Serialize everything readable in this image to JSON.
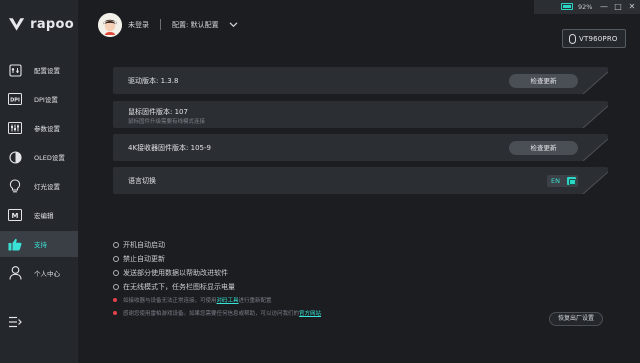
{
  "brand": {
    "name": "rapoo"
  },
  "sidebar": {
    "items": [
      {
        "label": "配置设置",
        "icon": "settings-sliders-icon"
      },
      {
        "label": "DPI设置",
        "icon": "dpi-icon"
      },
      {
        "label": "参数设置",
        "icon": "parameters-icon"
      },
      {
        "label": "OLED设置",
        "icon": "oled-icon"
      },
      {
        "label": "灯光设置",
        "icon": "lightbulb-icon"
      },
      {
        "label": "宏编辑",
        "icon": "macro-icon"
      },
      {
        "label": "支持",
        "icon": "thumbs-up-icon",
        "active": true
      },
      {
        "label": "个人中心",
        "icon": "user-icon"
      }
    ],
    "collapse_icon": "menu-collapse-icon"
  },
  "header": {
    "login_status": "未登录",
    "profile_label": "配置: 默认配置"
  },
  "window": {
    "battery_percent": "92%",
    "minimize_glyph": "—",
    "maximize_glyph": "□",
    "close_glyph": "✕"
  },
  "device": {
    "model": "VT960PRO"
  },
  "rows": {
    "driver": {
      "label": "驱动版本: 1.3.8",
      "button": "检查更新"
    },
    "mouse_fw": {
      "label": "鼠标固件版本: 107",
      "sub": "鼠标固件升级需要有线模式连接"
    },
    "receiver_fw": {
      "label": "4K接收器固件版本: 105-9",
      "button": "检查更新"
    },
    "language": {
      "label": "语言切换",
      "value": "EN"
    }
  },
  "options": [
    "开机自动启动",
    "禁止自动更新",
    "发送部分使用数据以帮助改进软件",
    "在无线模式下，任务栏图标显示电量"
  ],
  "notes": {
    "pairing_prefix": "如接收器与设备无法正常连接，可使用",
    "pairing_link": "对码工具",
    "pairing_suffix": "进行重新配置",
    "help_prefix": "感谢您使用雷柏游戏设备。如果您需要任何信息或帮助，可以访问我们的",
    "help_link": "官方网站"
  },
  "reset_button": "恢复出厂设置",
  "colors": {
    "accent": "#39e2d4",
    "background": "#1b1d21",
    "sidebar": "#24272c",
    "row": "#2b2e33",
    "warning_dot": "#e2424a"
  }
}
